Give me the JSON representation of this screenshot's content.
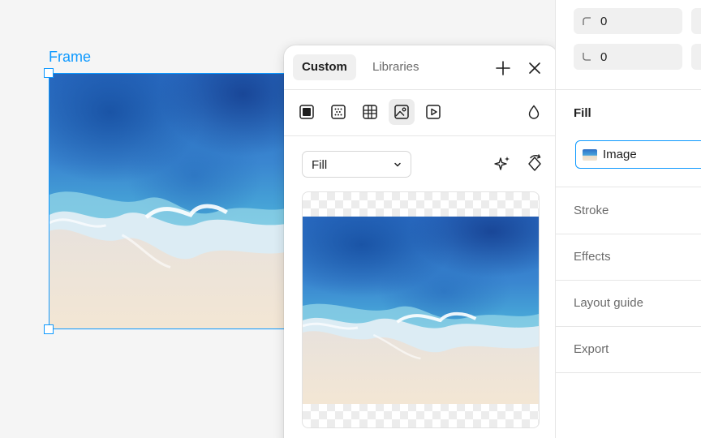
{
  "canvas": {
    "frame_label": "Frame"
  },
  "popover": {
    "tabs": [
      {
        "label": "Custom",
        "active": true
      },
      {
        "label": "Libraries",
        "active": false
      }
    ],
    "header_icons": [
      "plus-icon",
      "close-icon"
    ],
    "fill_types": [
      {
        "icon": "solid-fill-icon",
        "selected": false
      },
      {
        "icon": "gradient-fill-icon",
        "selected": false
      },
      {
        "icon": "pattern-fill-icon",
        "selected": false
      },
      {
        "icon": "image-fill-icon",
        "selected": true
      },
      {
        "icon": "video-fill-icon",
        "selected": false
      }
    ],
    "opacity_icon": "droplet-icon",
    "fill_mode": "Fill",
    "action_icons": [
      "sparkle-icon",
      "rotate-icon"
    ]
  },
  "panel": {
    "radius_top": "0",
    "radius_bottom": "0",
    "sections": {
      "fill": "Fill",
      "stroke": "Stroke",
      "effects": "Effects",
      "layout_guide": "Layout guide",
      "export": "Export"
    },
    "fill_item": "Image"
  },
  "colors": {
    "accent": "#0d99ff",
    "panel_bg": "#ffffff",
    "canvas_bg": "#f5f5f5",
    "muted_text": "#6b6b6b"
  }
}
